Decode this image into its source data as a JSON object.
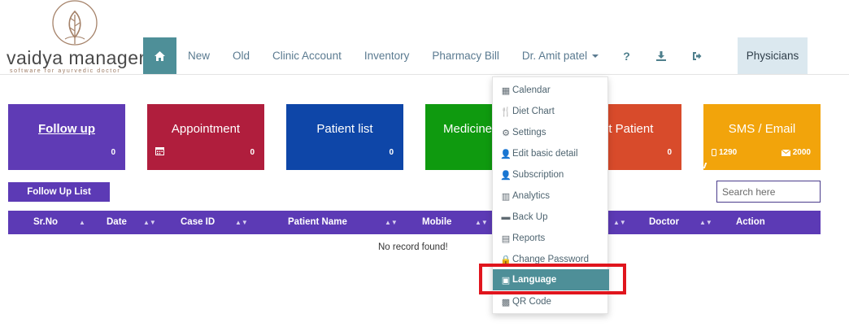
{
  "brand": {
    "title": "vaidya manager",
    "tagline": "software for ayurvedic doctor",
    "accent": "#4e8f98"
  },
  "nav": {
    "items": [
      {
        "label": "New"
      },
      {
        "label": "Old"
      },
      {
        "label": "Clinic Account"
      },
      {
        "label": "Inventory"
      },
      {
        "label": "Pharmacy Bill"
      },
      {
        "label": "Dr. Amit patel"
      }
    ],
    "help_icon": "?",
    "physicians_label": "Physicians"
  },
  "tiles": [
    {
      "label": "Follow up",
      "count": "0",
      "color": "#5f3bb5"
    },
    {
      "label": "Appointment",
      "count": "0",
      "color": "#b01e3d",
      "icon": "calendar-icon"
    },
    {
      "label": "Patient list",
      "count": "0",
      "color": "#0e46a8"
    },
    {
      "label": "Medicine",
      "count": "",
      "color": "#0f9a0f"
    },
    {
      "label": "nt Patient",
      "count": "0",
      "color": "#d84b2b"
    },
    {
      "label": "SMS / Email",
      "count_left": "1290",
      "count_right": "2000",
      "color": "#f2a40b"
    }
  ],
  "followup_list_label": "Follow Up List",
  "search": {
    "placeholder": "Search here"
  },
  "table": {
    "columns": [
      "Sr.No",
      "Date",
      "Case ID",
      "Patient Name",
      "Mobile",
      "Doctor",
      "Action"
    ],
    "empty_message": "No record found!"
  },
  "dropdown": {
    "items": [
      {
        "label": "Calendar",
        "icon": "calendar-icon"
      },
      {
        "label": "Diet Chart",
        "icon": "cutlery-icon"
      },
      {
        "label": "Settings",
        "icon": "gear-icon"
      },
      {
        "label": "Edit basic detail",
        "icon": "user-icon"
      },
      {
        "label": "Subscription",
        "icon": "user-icon"
      },
      {
        "label": "Analytics",
        "icon": "bar-chart-icon"
      },
      {
        "label": "Back Up",
        "icon": "archive-icon"
      },
      {
        "label": "Reports",
        "icon": "file-icon"
      },
      {
        "label": "Change Password",
        "icon": "lock-icon"
      },
      {
        "label": "Language",
        "icon": "language-icon",
        "active": true
      },
      {
        "label": "QR Code",
        "icon": "qrcode-icon"
      }
    ],
    "highlight_color": "#e0151d"
  }
}
